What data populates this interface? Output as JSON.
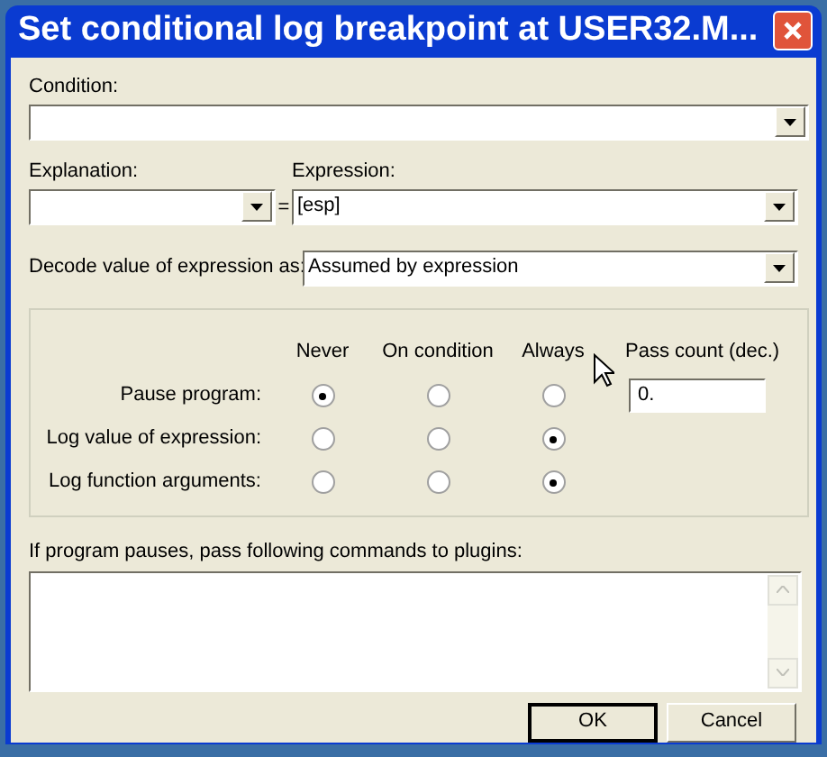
{
  "window": {
    "title": "Set conditional log breakpoint at USER32.M..."
  },
  "condition": {
    "label": "Condition:"
  },
  "explanation": {
    "label": "Explanation:"
  },
  "equals": "=",
  "expression": {
    "label": "Expression:",
    "value": "[esp]"
  },
  "decode": {
    "label": "Decode value of expression as:",
    "value": "Assumed by expression"
  },
  "options": {
    "columns": [
      "Never",
      "On condition",
      "Always"
    ],
    "pass_count": {
      "label": "Pass count (dec.)",
      "value": "0."
    },
    "rows": [
      {
        "label": "Pause program:",
        "choices": [
          {
            "selected": true
          },
          {
            "selected": false
          },
          {
            "selected": false
          }
        ]
      },
      {
        "label": "Log value of expression:",
        "choices": [
          {
            "selected": false
          },
          {
            "selected": false
          },
          {
            "selected": true
          }
        ]
      },
      {
        "label": "Log function arguments:",
        "choices": [
          {
            "selected": false
          },
          {
            "selected": false
          },
          {
            "selected": true
          }
        ]
      }
    ]
  },
  "commands": {
    "label": "If program pauses, pass following commands to plugins:"
  },
  "buttons": [
    {
      "label": "OK",
      "default": true
    },
    {
      "label": "Cancel",
      "default": false
    }
  ]
}
